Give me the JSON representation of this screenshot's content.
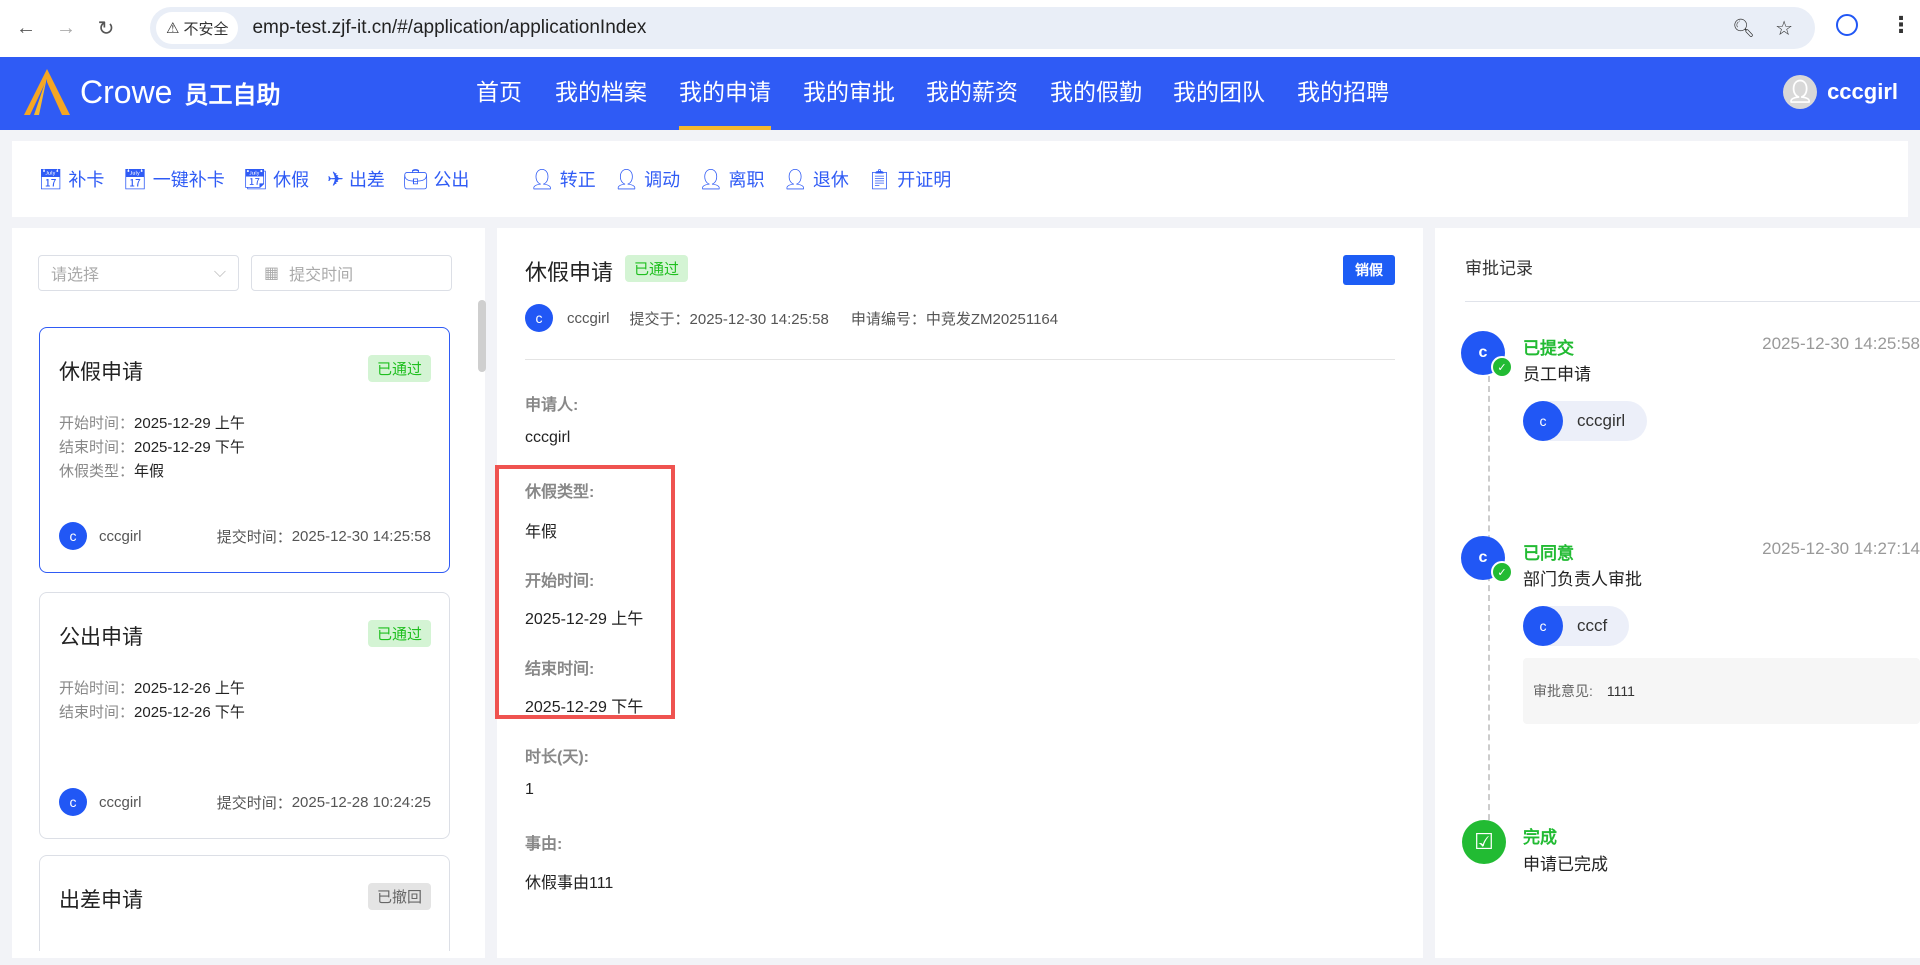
{
  "browser": {
    "insecure": "不安全",
    "url": "emp-test.zjf-it.cn/#/application/applicationIndex"
  },
  "header": {
    "brand": "Crowe",
    "app": "员工自助",
    "nav": [
      "首页",
      "我的档案",
      "我的申请",
      "我的审批",
      "我的薪资",
      "我的假勤",
      "我的团队",
      "我的招聘"
    ],
    "active": "我的申请",
    "user": "cccgirl"
  },
  "toolbar": [
    "补卡",
    "一键补卡",
    "休假",
    "出差",
    "公出",
    "转正",
    "调动",
    "离职",
    "退休",
    "开证明"
  ],
  "filters": {
    "select_placeholder": "请选择",
    "date_placeholder": "提交时间"
  },
  "cards": [
    {
      "title": "休假申请",
      "status": "已通过",
      "rows": [
        [
          "开始时间：",
          "2025-12-29 上午"
        ],
        [
          "结束时间：",
          "2025-12-29 下午"
        ],
        [
          "休假类型：",
          "年假"
        ]
      ],
      "avatar": "c",
      "user": "cccgirl",
      "submit_label": "提交时间：",
      "submit": "2025-12-30 14:25:58"
    },
    {
      "title": "公出申请",
      "status": "已通过",
      "rows": [
        [
          "开始时间：",
          "2025-12-26 上午"
        ],
        [
          "结束时间：",
          "2025-12-26 下午"
        ]
      ],
      "avatar": "c",
      "user": "cccgirl",
      "submit_label": "提交时间：",
      "submit": "2025-12-28 10:24:25"
    },
    {
      "title": "出差申请",
      "status": "已撤回"
    }
  ],
  "detail": {
    "title": "休假申请",
    "status": "已通过",
    "cancel_btn": "销假",
    "avatar": "c",
    "user": "cccgirl",
    "submitted": "提交于：2025-12-30 14:25:58",
    "number": "申请编号：中竞发ZM20251164",
    "fields": [
      [
        "申请人:",
        "cccgirl"
      ],
      [
        "休假类型:",
        "年假"
      ],
      [
        "开始时间:",
        "2025-12-29 上午"
      ],
      [
        "结束时间:",
        "2025-12-29 下午"
      ],
      [
        "时长(天):",
        "1"
      ],
      [
        "事由:",
        "休假事由111"
      ]
    ]
  },
  "record": {
    "title": "审批记录",
    "items": [
      {
        "status": "已提交",
        "time": "2025-12-30 14:25:58",
        "desc": "员工申请",
        "avatar": "c",
        "user": "cccgirl"
      },
      {
        "status": "已同意",
        "time": "2025-12-30 14:27:14",
        "desc": "部门负责人审批",
        "avatar": "c",
        "user": "cccf",
        "opinion_label": "审批意见:",
        "opinion": "1111"
      },
      {
        "status": "完成",
        "desc": "申请已完成"
      }
    ]
  }
}
